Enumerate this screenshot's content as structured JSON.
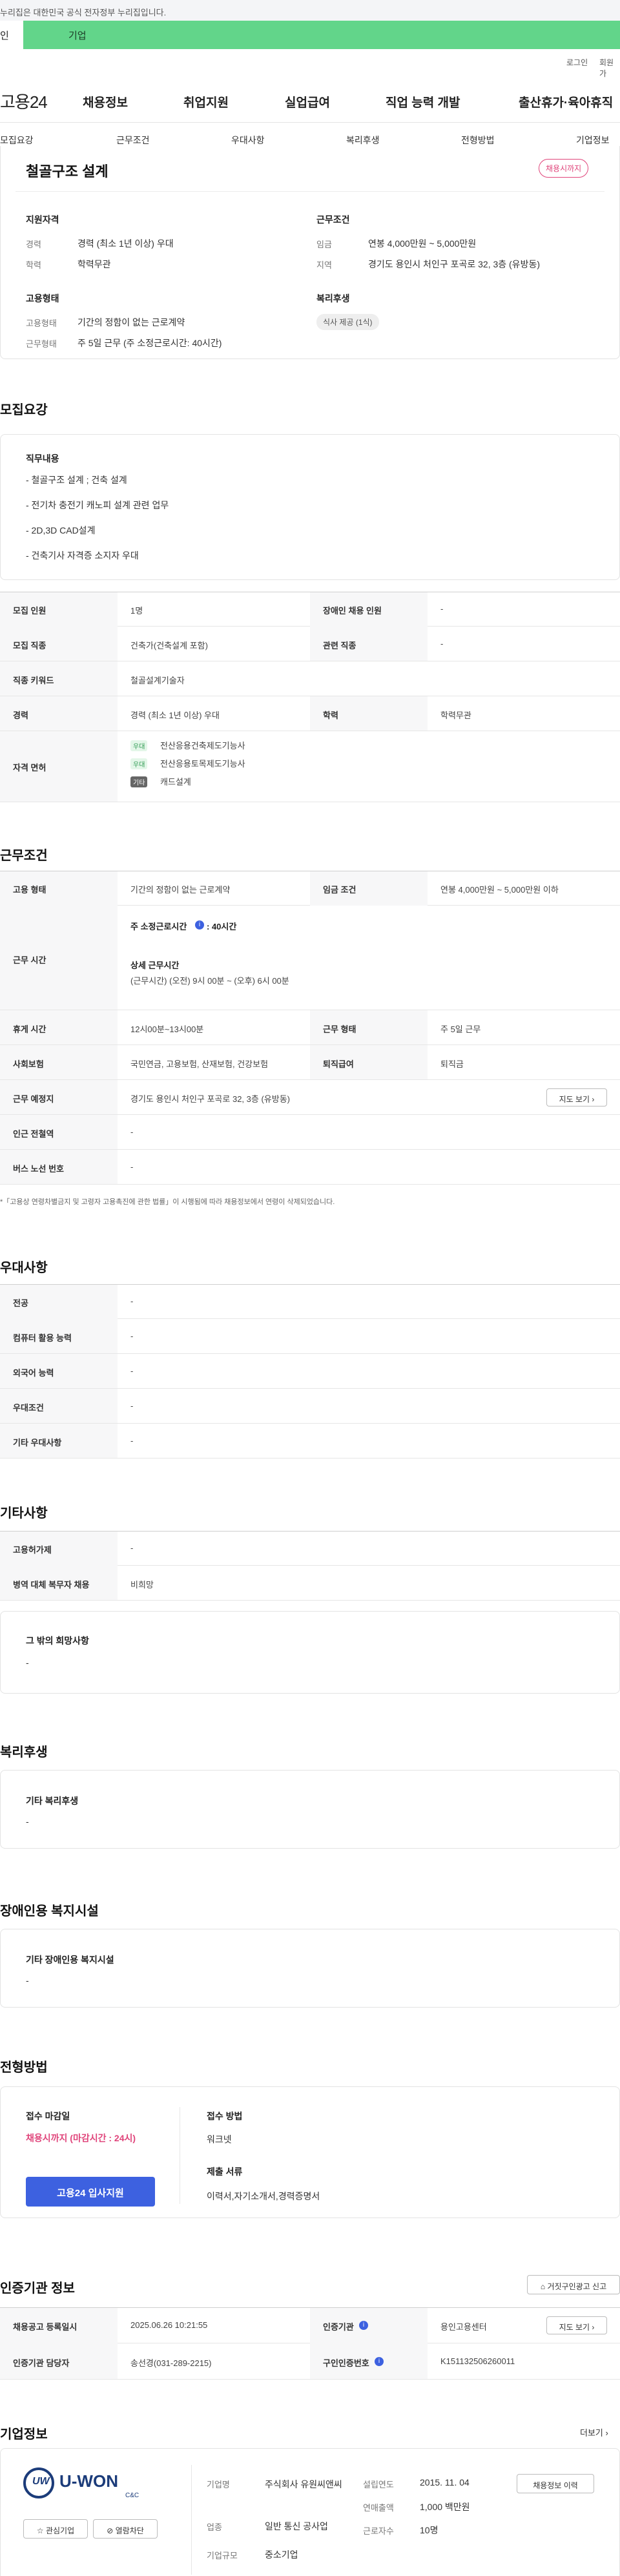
{
  "gov_notice": "누리집은 대한민국 공식 전자정부 누리집입니다.",
  "top_tabs": {
    "personal": "인",
    "company": "기업"
  },
  "util": {
    "login": "로그인",
    "join": "회원가"
  },
  "gnb": {
    "logo": "고용24",
    "items": [
      "채용정보",
      "취업지원",
      "실업급여",
      "직업 능력 개발",
      "출산휴가·육아휴직"
    ]
  },
  "subnav": [
    "모집요강",
    "근무조건",
    "우대사항",
    "복리후생",
    "전형방법",
    "기업정보"
  ],
  "job": {
    "title": "철골구조 설계",
    "status_badge": "채용시까지",
    "qual_title": "지원자격",
    "cond_title": "근무조건",
    "career_k": "경력",
    "career_v": "경력 (최소 1년 이상) 우대",
    "edu_k": "학력",
    "edu_v": "학력무관",
    "wage_k": "임금",
    "wage_v": "연봉 4,000만원 ~ 5,000만원",
    "area_k": "지역",
    "area_v": "경기도 용인시 처인구 포곡로 32, 3층 (유방동)",
    "emp_title": "고용형태",
    "emptype_k": "고용형태",
    "emptype_v": "기간의 정함이 없는 근로계약",
    "worktype_k": "근무형태",
    "worktype_v": "주 5일 근무 (주 소정근로시간: 40시간)",
    "welfare_title": "복리후생",
    "welfare_chip": "식사 제공 (1식)"
  },
  "recruit": {
    "section_title": "모집요강",
    "duty_title": "직무내용",
    "duties": [
      "- 철골구조 설계 ; 건축 설계",
      "- 전기차 충전기 캐노피 설계 관련 업무",
      "- 2D,3D CAD설계",
      "- 건축기사 자격증 소지자 우대"
    ],
    "rows": {
      "headcount_k": "모집 인원",
      "headcount_v": "1명",
      "disabled_k": "장애인 채용 인원",
      "disabled_v": "-",
      "job_k": "모집 직종",
      "job_v": "건축가(건축설계 포함)",
      "related_k": "관련 직종",
      "related_v": "-",
      "keyword_k": "직종 키워드",
      "keyword_v": "철골설계기술자",
      "career_k": "경력",
      "career_v": "경력 (최소 1년 이상) 우대",
      "edu_k": "학력",
      "edu_v": "학력무관",
      "license_k": "자격 면허",
      "licenses": [
        {
          "tag": "우대",
          "name": "전산응용건축제도기능사"
        },
        {
          "tag": "우대",
          "name": "전산응용토목제도기능사"
        },
        {
          "tag": "기타",
          "name": "캐드설계"
        }
      ]
    }
  },
  "work": {
    "section_title": "근무조건",
    "emptype_k": "고용 형태",
    "emptype_v": "기간의 정함이 없는 근로계약",
    "wage_k": "임금 조건",
    "wage_v": "연봉 4,000만원 ~ 5,000만원 이하",
    "hours_k": "근무 시간",
    "hours_weekly": "주 소정근로시간",
    "hours_weekly_v": ": 40시간",
    "hours_detail_title": "상세 근무시간",
    "hours_detail_v": "(근무시간) (오전) 9시 00분 ~ (오후) 6시 00분",
    "break_k": "휴게 시간",
    "break_v": "12시00분~13시00분",
    "worktype_k": "근무 형태",
    "worktype_v": "주 5일 근무",
    "insurance_k": "사회보험",
    "insurance_v": "국민연금, 고용보험, 산재보험, 건강보험",
    "severance_k": "퇴직급여",
    "severance_v": "퇴직금",
    "place_k": "근무 예정지",
    "place_v": "경기도 용인시 처인구 포곡로 32, 3층 (유방동)",
    "map_btn": "지도 보기",
    "subway_k": "인근 전철역",
    "subway_v": "-",
    "bus_k": "버스 노선 번호",
    "bus_v": "-",
    "notice": "*「고용상 연령차별금지 및 고령자 고용촉진에 관한 법률」이 시행됨에 따라 채용정보에서 연령이 삭제되었습니다."
  },
  "pref": {
    "section_title": "우대사항",
    "major_k": "전공",
    "major_v": "-",
    "pc_k": "컴퓨터 활용 능력",
    "pc_v": "-",
    "lang_k": "외국어 능력",
    "lang_v": "-",
    "cond_k": "우대조건",
    "cond_v": "-",
    "etc_k": "기타 우대사항",
    "etc_v": "-"
  },
  "etc": {
    "section_title": "기타사항",
    "insure_k": "고용허가제",
    "insure_v": "-",
    "military_k": "병역 대체 복무자 채용",
    "military_v": "비희망",
    "wish_title": "그 밖의 희망사항",
    "wish_v": "-"
  },
  "welfare": {
    "section_title": "복리후생",
    "box_title": "기타 복리후생",
    "box_v": "-"
  },
  "disabled": {
    "section_title": "장애인용 복지시설",
    "box_title": "기타 장애인용 복지시설",
    "box_v": "-"
  },
  "selection": {
    "section_title": "전형방법",
    "deadline_title": "접수 마감일",
    "deadline_v": "채용시까지 (마감시간 : 24시)",
    "apply_btn": "고용24 입사지원",
    "method_title": "접수 방법",
    "method_v": "워크넷",
    "docs_title": "제출 서류",
    "docs_v": "이력서,자기소개서,경력증명서"
  },
  "cert": {
    "section_title": "인증기관 정보",
    "report_btn": "거짓구인광고 신고",
    "reg_k": "채용공고 등록일시",
    "reg_v": "2025.06.26 10:21:55",
    "agency_k": "인증기관",
    "agency_v": "용인고용센터",
    "map_btn": "지도 보기",
    "manager_k": "인증기관 담당자",
    "manager_v": "송선경(031-289-2215)",
    "jobno_k": "구인인증번호",
    "jobno_v": "K151132506260011"
  },
  "company": {
    "section_title": "기업정보",
    "more": "더보기",
    "logo_text": "U-WON",
    "logo_sub": "C&C",
    "interest_btn": "관심기업",
    "block_btn": "열람차단",
    "name_k": "기업명",
    "name_v": "주식회사 유원씨앤씨",
    "industry_k": "업종",
    "industry_v": "일반 통신 공사업",
    "size_k": "기업규모",
    "size_v": "중소기업",
    "founded_k": "설립연도",
    "founded_v": "2015. 11. 04",
    "sales_k": "연매출액",
    "sales_v": "1,000 백만원",
    "staff_k": "근로자수",
    "staff_v": "10명",
    "jobs_btn": "채용정보 이력"
  }
}
